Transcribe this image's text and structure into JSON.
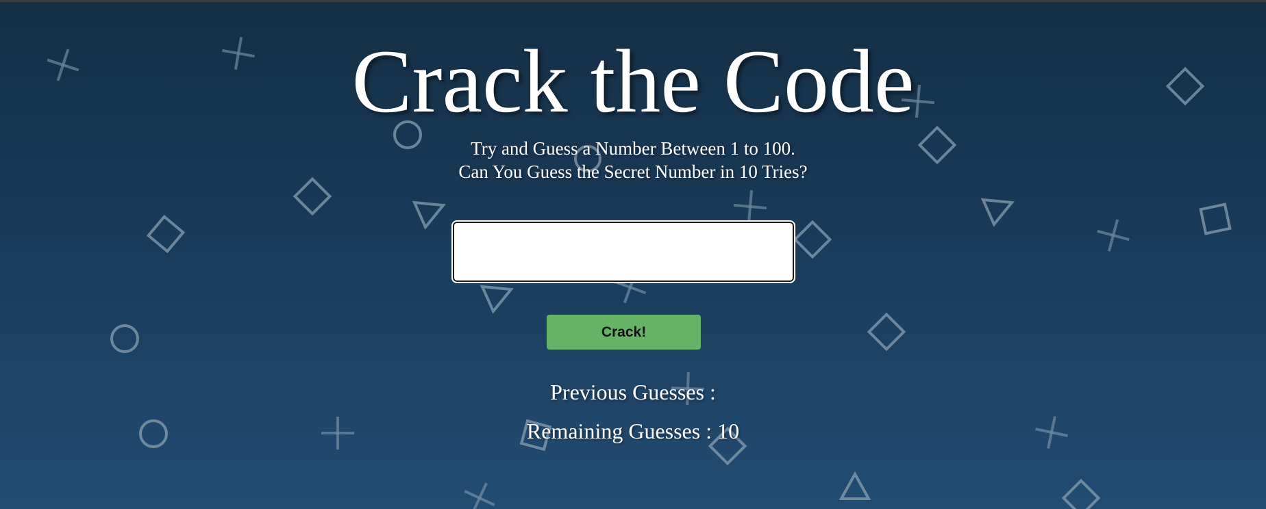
{
  "page": {
    "title": "Crack the Code",
    "subtitle_line1": "Try and Guess a Number Between 1 to 100.",
    "subtitle_line2": "Can You Guess the Secret Number in 10 Tries?"
  },
  "form": {
    "guess_value": "",
    "crack_button_label": "Crack!"
  },
  "status": {
    "previous_guesses_label": "Previous Guesses :",
    "previous_guesses": "",
    "remaining_label": "Remaining Guesses :",
    "remaining_value": "10"
  },
  "colors": {
    "background_top": "#142f45",
    "background_bottom": "#234c72",
    "button": "#66b266",
    "shapes": "#8a9fb0"
  },
  "background_shape_types": [
    "cross",
    "circle",
    "diamond",
    "triangle",
    "square"
  ]
}
